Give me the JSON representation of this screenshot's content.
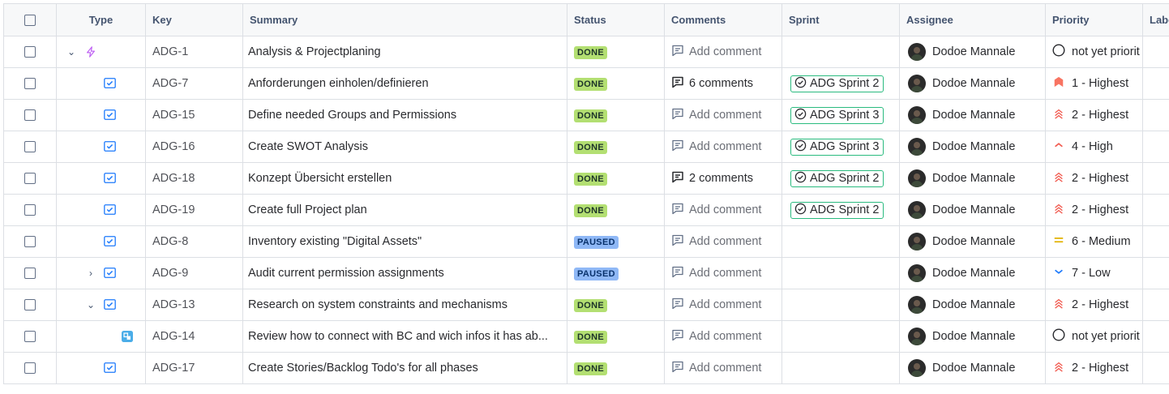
{
  "columns": {
    "type": "Type",
    "key": "Key",
    "summary": "Summary",
    "status": "Status",
    "comments": "Comments",
    "sprint": "Sprint",
    "assignee": "Assignee",
    "priority": "Priority",
    "labels": "Labe"
  },
  "rows": [
    {
      "key": "ADG-1",
      "summary": "Analysis & Projectplaning",
      "status": "DONE",
      "comment": "Add comment",
      "sprint": "",
      "assignee": "Dodoe Mannale",
      "priority": "not yet priorit",
      "type": "epic",
      "chevron": "down",
      "priority_icon": "circle"
    },
    {
      "key": "ADG-7",
      "summary": "Anforderungen einholen/definieren",
      "status": "DONE",
      "comment": "6 comments",
      "sprint": "ADG Sprint 2",
      "assignee": "Dodoe Mannale",
      "priority": "1 - Highest",
      "type": "task",
      "chevron": "",
      "priority_icon": "blocker"
    },
    {
      "key": "ADG-15",
      "summary": "Define needed Groups and Permissions",
      "status": "DONE",
      "comment": "Add comment",
      "sprint": "ADG Sprint 3",
      "assignee": "Dodoe Mannale",
      "priority": "2 - Highest",
      "type": "task",
      "chevron": "",
      "priority_icon": "highest"
    },
    {
      "key": "ADG-16",
      "summary": "Create SWOT Analysis",
      "status": "DONE",
      "comment": "Add comment",
      "sprint": "ADG Sprint 3",
      "assignee": "Dodoe Mannale",
      "priority": "4 - High",
      "type": "task",
      "chevron": "",
      "priority_icon": "high"
    },
    {
      "key": "ADG-18",
      "summary": "Konzept Übersicht erstellen",
      "status": "DONE",
      "comment": "2 comments",
      "sprint": "ADG Sprint 2",
      "assignee": "Dodoe Mannale",
      "priority": "2 - Highest",
      "type": "task",
      "chevron": "",
      "priority_icon": "highest"
    },
    {
      "key": "ADG-19",
      "summary": "Create full Project plan",
      "status": "DONE",
      "comment": "Add comment",
      "sprint": "ADG Sprint 2",
      "assignee": "Dodoe Mannale",
      "priority": "2 - Highest",
      "type": "task",
      "chevron": "",
      "priority_icon": "highest"
    },
    {
      "key": "ADG-8",
      "summary": "Inventory existing \"Digital Assets\"",
      "status": "PAUSED",
      "comment": "Add comment",
      "sprint": "",
      "assignee": "Dodoe Mannale",
      "priority": "6 - Medium",
      "type": "task",
      "chevron": "",
      "priority_icon": "medium"
    },
    {
      "key": "ADG-9",
      "summary": "Audit current permission assignments",
      "status": "PAUSED",
      "comment": "Add comment",
      "sprint": "",
      "assignee": "Dodoe Mannale",
      "priority": "7 - Low",
      "type": "task",
      "chevron": "right",
      "priority_icon": "low"
    },
    {
      "key": "ADG-13",
      "summary": "Research on system constraints and mechanisms",
      "status": "DONE",
      "comment": "Add comment",
      "sprint": "",
      "assignee": "Dodoe Mannale",
      "priority": "2 - Highest",
      "type": "task",
      "chevron": "down",
      "priority_icon": "highest"
    },
    {
      "key": "ADG-14",
      "summary": "Review how to connect with BC and wich infos it has ab...",
      "status": "DONE",
      "comment": "Add comment",
      "sprint": "",
      "assignee": "Dodoe Mannale",
      "priority": "not yet priorit",
      "type": "subtask",
      "chevron": "",
      "priority_icon": "circle"
    },
    {
      "key": "ADG-17",
      "summary": "Create Stories/Backlog Todo's for all phases",
      "status": "DONE",
      "comment": "Add comment",
      "sprint": "",
      "assignee": "Dodoe Mannale",
      "priority": "2 - Highest",
      "type": "task",
      "chevron": "",
      "priority_icon": "highest"
    }
  ],
  "colors": {
    "done_badge": "#b3df72",
    "paused_badge": "#8fb8f6",
    "sprint_border": "#2abb7f",
    "epic_icon": "#bf63f3",
    "task_icon": "#1d7afc",
    "highest": "#f15b50",
    "medium": "#e2b203",
    "low": "#1d7afc"
  }
}
